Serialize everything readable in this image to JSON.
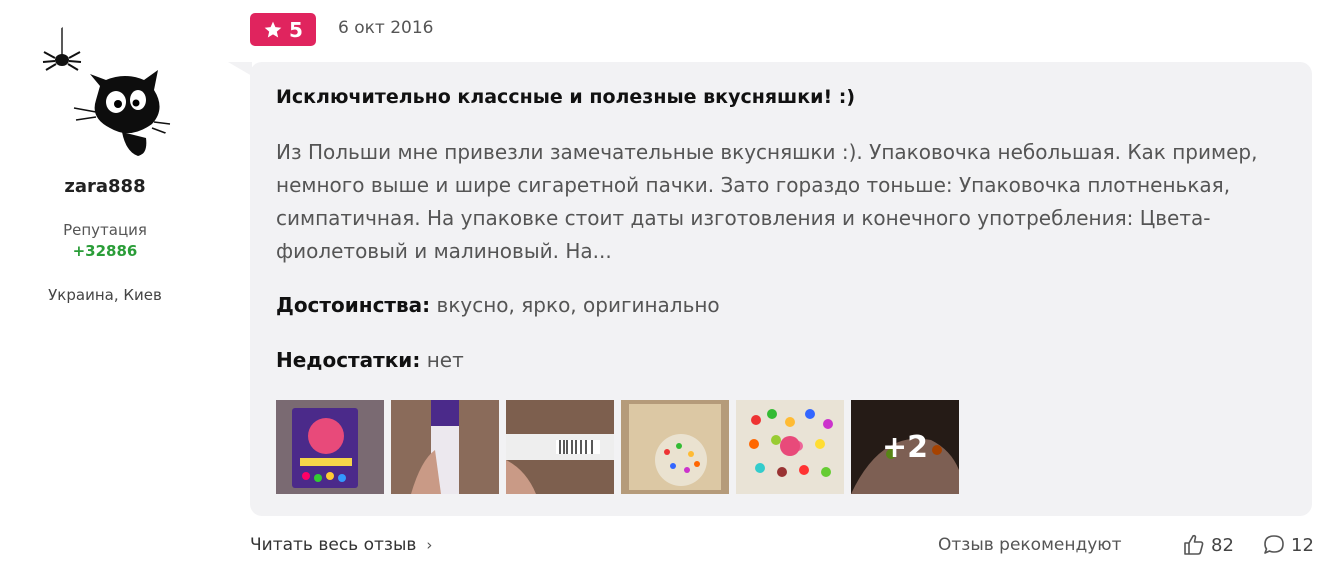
{
  "user": {
    "username": "zara888",
    "reputation_label": "Репутация",
    "reputation_value": "+32886",
    "location": "Украина, Киев"
  },
  "review": {
    "rating": "5",
    "date": "6 окт 2016",
    "title": "Исключительно классные и полезные вкусняшки! :)",
    "body": "Из Польши мне привезли замечательные вкусняшки :). Упаковочка небольшая. Как пример, немного выше и шире сигаретной пачки. Зато гораздо тоньше: Упаковочка плотненькая, симпатичная. На упаковке стоит даты изготовления и конечного употребления: Цвета-фиолетовый и малиновый. На...",
    "pros_label": "Достоинства:",
    "pros_value": "вкусно, ярко, оригинально",
    "cons_label": "Недостатки:",
    "cons_value": "нет",
    "more_photos": "+2"
  },
  "footer": {
    "read_full": "Читать весь отзыв",
    "recommend": "Отзыв рекомендуют",
    "likes": "82",
    "comments": "12"
  },
  "colors": {
    "rating_badge": "#e0245e",
    "reputation": "#2a9d38",
    "bubble": "#f2f2f4"
  },
  "icons": [
    "spider-cat-avatar",
    "star-icon",
    "chevron-right-icon",
    "thumbs-up-icon",
    "comment-icon"
  ]
}
